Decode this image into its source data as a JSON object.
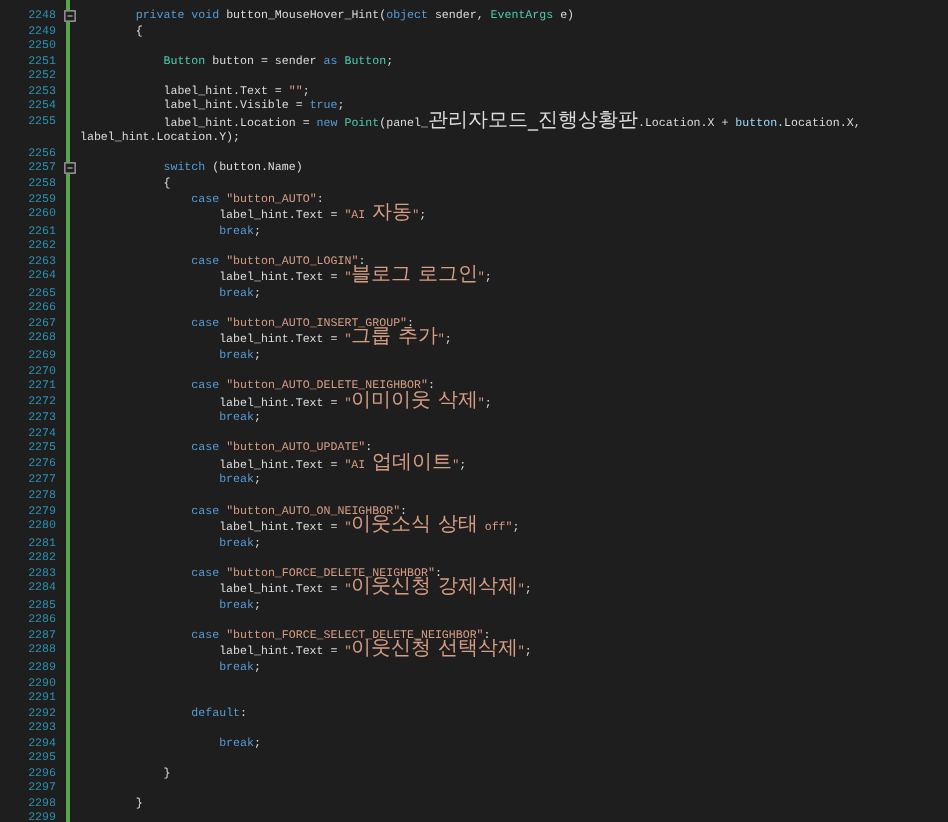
{
  "editor": {
    "lines": [
      {
        "n": "2248",
        "fold": true,
        "tokens": [
          {
            "kind": "kw",
            "text": "        private void "
          },
          {
            "kind": "txt",
            "text": "button_MouseHover_Hint("
          },
          {
            "kind": "kw",
            "text": "object"
          },
          {
            "kind": "txt",
            "text": " sender, "
          },
          {
            "kind": "type",
            "text": "EventArgs"
          },
          {
            "kind": "txt",
            "text": " e)"
          }
        ]
      },
      {
        "n": "2249",
        "fold": false,
        "tokens": [
          {
            "kind": "txt",
            "text": "        {"
          }
        ]
      },
      {
        "n": "2250",
        "fold": false
      },
      {
        "n": "2251",
        "fold": false,
        "tokens": [
          {
            "kind": "type",
            "text": "            Button"
          },
          {
            "kind": "txt",
            "text": " button = sender "
          },
          {
            "kind": "kw",
            "text": "as"
          },
          {
            "kind": "type",
            "text": " Button"
          },
          {
            "kind": "txt",
            "text": ";"
          }
        ]
      },
      {
        "n": "2252",
        "fold": false
      },
      {
        "n": "2253",
        "fold": false,
        "tokens": [
          {
            "kind": "txt",
            "text": "            label_hint.Text = "
          },
          {
            "kind": "str",
            "text": "\"\""
          },
          {
            "kind": "txt",
            "text": ";"
          }
        ]
      },
      {
        "n": "2254",
        "fold": false,
        "tokens": [
          {
            "kind": "txt",
            "text": "            label_hint.Visible = "
          },
          {
            "kind": "kw",
            "text": "true"
          },
          {
            "kind": "txt",
            "text": ";"
          }
        ]
      },
      {
        "n": "2255",
        "fold": false,
        "tokens": [
          {
            "kind": "txt",
            "text": "            label_hint.Location = "
          },
          {
            "kind": "kw",
            "text": "new"
          },
          {
            "kind": "type",
            "text": " Point"
          },
          {
            "kind": "txt",
            "text": "(panel_관리자모드_진행상황판.Location.X + "
          },
          {
            "kind": "id",
            "text": "button"
          },
          {
            "kind": "txt",
            "text": ".Location.X, label_hint.Location.Y);"
          }
        ]
      },
      {
        "n": "2256",
        "fold": false
      },
      {
        "n": "2257",
        "fold": true,
        "tokens": [
          {
            "kind": "kw",
            "text": "            switch"
          },
          {
            "kind": "txt",
            "text": " (button.Name)"
          }
        ]
      },
      {
        "n": "2258",
        "fold": false,
        "tokens": [
          {
            "kind": "txt",
            "text": "            {"
          }
        ]
      },
      {
        "n": "2259",
        "fold": false,
        "tokens": [
          {
            "kind": "kw",
            "text": "                case "
          },
          {
            "kind": "str",
            "text": "\"button_AUTO\""
          },
          {
            "kind": "txt",
            "text": ":"
          }
        ]
      },
      {
        "n": "2260",
        "fold": false,
        "tokens": [
          {
            "kind": "txt",
            "text": "                    label_hint.Text = "
          },
          {
            "kind": "str",
            "text": "\"AI 자동\""
          },
          {
            "kind": "txt",
            "text": ";"
          }
        ]
      },
      {
        "n": "2261",
        "fold": false,
        "tokens": [
          {
            "kind": "kw",
            "text": "                    break"
          },
          {
            "kind": "txt",
            "text": ";"
          }
        ]
      },
      {
        "n": "2262",
        "fold": false
      },
      {
        "n": "2263",
        "fold": false,
        "tokens": [
          {
            "kind": "kw",
            "text": "                case "
          },
          {
            "kind": "str",
            "text": "\"button_AUTO_LOGIN\""
          },
          {
            "kind": "txt",
            "text": ":"
          }
        ]
      },
      {
        "n": "2264",
        "fold": false,
        "tokens": [
          {
            "kind": "txt",
            "text": "                    label_hint.Text = "
          },
          {
            "kind": "str",
            "text": "\"블로그 로그인\""
          },
          {
            "kind": "txt",
            "text": ";"
          }
        ]
      },
      {
        "n": "2265",
        "fold": false,
        "tokens": [
          {
            "kind": "kw",
            "text": "                    break"
          },
          {
            "kind": "txt",
            "text": ";"
          }
        ]
      },
      {
        "n": "2266",
        "fold": false
      },
      {
        "n": "2267",
        "fold": false,
        "tokens": [
          {
            "kind": "kw",
            "text": "                case "
          },
          {
            "kind": "str",
            "text": "\"button_AUTO_INSERT_GROUP\""
          },
          {
            "kind": "txt",
            "text": ":"
          }
        ]
      },
      {
        "n": "2268",
        "fold": false,
        "tokens": [
          {
            "kind": "txt",
            "text": "                    label_hint.Text = "
          },
          {
            "kind": "str",
            "text": "\"그룹 추가\""
          },
          {
            "kind": "txt",
            "text": ";"
          }
        ]
      },
      {
        "n": "2269",
        "fold": false,
        "tokens": [
          {
            "kind": "kw",
            "text": "                    break"
          },
          {
            "kind": "txt",
            "text": ";"
          }
        ]
      },
      {
        "n": "2270",
        "fold": false
      },
      {
        "n": "2271",
        "fold": false,
        "tokens": [
          {
            "kind": "kw",
            "text": "                case "
          },
          {
            "kind": "str",
            "text": "\"button_AUTO_DELETE_NEIGHBOR\""
          },
          {
            "kind": "txt",
            "text": ":"
          }
        ]
      },
      {
        "n": "2272",
        "fold": false,
        "tokens": [
          {
            "kind": "txt",
            "text": "                    label_hint.Text = "
          },
          {
            "kind": "str",
            "text": "\"이미이웃 삭제\""
          },
          {
            "kind": "txt",
            "text": ";"
          }
        ]
      },
      {
        "n": "2273",
        "fold": false,
        "tokens": [
          {
            "kind": "kw",
            "text": "                    break"
          },
          {
            "kind": "txt",
            "text": ";"
          }
        ]
      },
      {
        "n": "2274",
        "fold": false
      },
      {
        "n": "2275",
        "fold": false,
        "tokens": [
          {
            "kind": "kw",
            "text": "                case "
          },
          {
            "kind": "str",
            "text": "\"button_AUTO_UPDATE\""
          },
          {
            "kind": "txt",
            "text": ":"
          }
        ]
      },
      {
        "n": "2276",
        "fold": false,
        "tokens": [
          {
            "kind": "txt",
            "text": "                    label_hint.Text = "
          },
          {
            "kind": "str",
            "text": "\"AI 업데이트\""
          },
          {
            "kind": "txt",
            "text": ";"
          }
        ]
      },
      {
        "n": "2277",
        "fold": false,
        "tokens": [
          {
            "kind": "kw",
            "text": "                    break"
          },
          {
            "kind": "txt",
            "text": ";"
          }
        ]
      },
      {
        "n": "2278",
        "fold": false
      },
      {
        "n": "2279",
        "fold": false,
        "tokens": [
          {
            "kind": "kw",
            "text": "                case "
          },
          {
            "kind": "str",
            "text": "\"button_AUTO_ON_NEIGHBOR\""
          },
          {
            "kind": "txt",
            "text": ":"
          }
        ]
      },
      {
        "n": "2280",
        "fold": false,
        "tokens": [
          {
            "kind": "txt",
            "text": "                    label_hint.Text = "
          },
          {
            "kind": "str",
            "text": "\"이웃소식 상태 off\""
          },
          {
            "kind": "txt",
            "text": ";"
          }
        ]
      },
      {
        "n": "2281",
        "fold": false,
        "tokens": [
          {
            "kind": "kw",
            "text": "                    break"
          },
          {
            "kind": "txt",
            "text": ";"
          }
        ]
      },
      {
        "n": "2282",
        "fold": false
      },
      {
        "n": "2283",
        "fold": false,
        "tokens": [
          {
            "kind": "kw",
            "text": "                case "
          },
          {
            "kind": "str",
            "text": "\"button_FORCE_DELETE_NEIGHBOR\""
          },
          {
            "kind": "txt",
            "text": ":"
          }
        ]
      },
      {
        "n": "2284",
        "fold": false,
        "tokens": [
          {
            "kind": "txt",
            "text": "                    label_hint.Text = "
          },
          {
            "kind": "str",
            "text": "\"이웃신청 강제삭제\""
          },
          {
            "kind": "txt",
            "text": ";"
          }
        ]
      },
      {
        "n": "2285",
        "fold": false,
        "tokens": [
          {
            "kind": "kw",
            "text": "                    break"
          },
          {
            "kind": "txt",
            "text": ";"
          }
        ]
      },
      {
        "n": "2286",
        "fold": false
      },
      {
        "n": "2287",
        "fold": false,
        "tokens": [
          {
            "kind": "kw",
            "text": "                case "
          },
          {
            "kind": "str",
            "text": "\"button_FORCE_SELECT_DELETE_NEIGHBOR\""
          },
          {
            "kind": "txt",
            "text": ":"
          }
        ]
      },
      {
        "n": "2288",
        "fold": false,
        "tokens": [
          {
            "kind": "txt",
            "text": "                    label_hint.Text = "
          },
          {
            "kind": "str",
            "text": "\"이웃신청 선택삭제\""
          },
          {
            "kind": "txt",
            "text": ";"
          }
        ]
      },
      {
        "n": "2289",
        "fold": false,
        "tokens": [
          {
            "kind": "kw",
            "text": "                    break"
          },
          {
            "kind": "txt",
            "text": ";"
          }
        ]
      },
      {
        "n": "2290",
        "fold": false
      },
      {
        "n": "2291",
        "fold": false
      },
      {
        "n": "2292",
        "fold": false,
        "tokens": [
          {
            "kind": "kw",
            "text": "                default"
          },
          {
            "kind": "txt",
            "text": ":"
          }
        ]
      },
      {
        "n": "2293",
        "fold": false
      },
      {
        "n": "2294",
        "fold": false,
        "tokens": [
          {
            "kind": "kw",
            "text": "                    break"
          },
          {
            "kind": "txt",
            "text": ";"
          }
        ]
      },
      {
        "n": "2295",
        "fold": false
      },
      {
        "n": "2296",
        "fold": false,
        "tokens": [
          {
            "kind": "txt",
            "text": "            }"
          }
        ]
      },
      {
        "n": "2297",
        "fold": false
      },
      {
        "n": "2298",
        "fold": false,
        "tokens": [
          {
            "kind": "txt",
            "text": "        }"
          }
        ]
      },
      {
        "n": "2299",
        "fold": false
      }
    ]
  }
}
